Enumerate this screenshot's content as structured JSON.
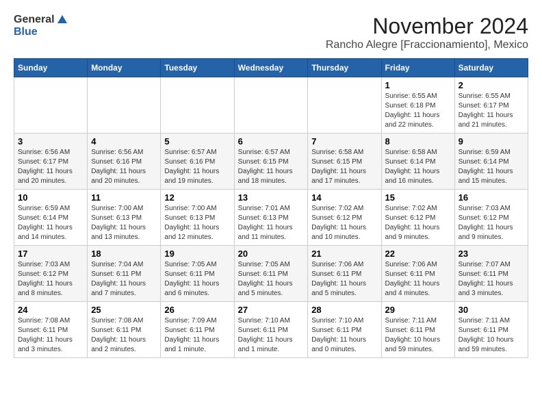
{
  "logo": {
    "general": "General",
    "blue": "Blue"
  },
  "title": "November 2024",
  "subtitle": "Rancho Alegre [Fraccionamiento], Mexico",
  "headers": [
    "Sunday",
    "Monday",
    "Tuesday",
    "Wednesday",
    "Thursday",
    "Friday",
    "Saturday"
  ],
  "weeks": [
    [
      {
        "day": "",
        "info": ""
      },
      {
        "day": "",
        "info": ""
      },
      {
        "day": "",
        "info": ""
      },
      {
        "day": "",
        "info": ""
      },
      {
        "day": "",
        "info": ""
      },
      {
        "day": "1",
        "info": "Sunrise: 6:55 AM\nSunset: 6:18 PM\nDaylight: 11 hours and 22 minutes."
      },
      {
        "day": "2",
        "info": "Sunrise: 6:55 AM\nSunset: 6:17 PM\nDaylight: 11 hours and 21 minutes."
      }
    ],
    [
      {
        "day": "3",
        "info": "Sunrise: 6:56 AM\nSunset: 6:17 PM\nDaylight: 11 hours and 20 minutes."
      },
      {
        "day": "4",
        "info": "Sunrise: 6:56 AM\nSunset: 6:16 PM\nDaylight: 11 hours and 20 minutes."
      },
      {
        "day": "5",
        "info": "Sunrise: 6:57 AM\nSunset: 6:16 PM\nDaylight: 11 hours and 19 minutes."
      },
      {
        "day": "6",
        "info": "Sunrise: 6:57 AM\nSunset: 6:15 PM\nDaylight: 11 hours and 18 minutes."
      },
      {
        "day": "7",
        "info": "Sunrise: 6:58 AM\nSunset: 6:15 PM\nDaylight: 11 hours and 17 minutes."
      },
      {
        "day": "8",
        "info": "Sunrise: 6:58 AM\nSunset: 6:14 PM\nDaylight: 11 hours and 16 minutes."
      },
      {
        "day": "9",
        "info": "Sunrise: 6:59 AM\nSunset: 6:14 PM\nDaylight: 11 hours and 15 minutes."
      }
    ],
    [
      {
        "day": "10",
        "info": "Sunrise: 6:59 AM\nSunset: 6:14 PM\nDaylight: 11 hours and 14 minutes."
      },
      {
        "day": "11",
        "info": "Sunrise: 7:00 AM\nSunset: 6:13 PM\nDaylight: 11 hours and 13 minutes."
      },
      {
        "day": "12",
        "info": "Sunrise: 7:00 AM\nSunset: 6:13 PM\nDaylight: 11 hours and 12 minutes."
      },
      {
        "day": "13",
        "info": "Sunrise: 7:01 AM\nSunset: 6:13 PM\nDaylight: 11 hours and 11 minutes."
      },
      {
        "day": "14",
        "info": "Sunrise: 7:02 AM\nSunset: 6:12 PM\nDaylight: 11 hours and 10 minutes."
      },
      {
        "day": "15",
        "info": "Sunrise: 7:02 AM\nSunset: 6:12 PM\nDaylight: 11 hours and 9 minutes."
      },
      {
        "day": "16",
        "info": "Sunrise: 7:03 AM\nSunset: 6:12 PM\nDaylight: 11 hours and 9 minutes."
      }
    ],
    [
      {
        "day": "17",
        "info": "Sunrise: 7:03 AM\nSunset: 6:12 PM\nDaylight: 11 hours and 8 minutes."
      },
      {
        "day": "18",
        "info": "Sunrise: 7:04 AM\nSunset: 6:11 PM\nDaylight: 11 hours and 7 minutes."
      },
      {
        "day": "19",
        "info": "Sunrise: 7:05 AM\nSunset: 6:11 PM\nDaylight: 11 hours and 6 minutes."
      },
      {
        "day": "20",
        "info": "Sunrise: 7:05 AM\nSunset: 6:11 PM\nDaylight: 11 hours and 5 minutes."
      },
      {
        "day": "21",
        "info": "Sunrise: 7:06 AM\nSunset: 6:11 PM\nDaylight: 11 hours and 5 minutes."
      },
      {
        "day": "22",
        "info": "Sunrise: 7:06 AM\nSunset: 6:11 PM\nDaylight: 11 hours and 4 minutes."
      },
      {
        "day": "23",
        "info": "Sunrise: 7:07 AM\nSunset: 6:11 PM\nDaylight: 11 hours and 3 minutes."
      }
    ],
    [
      {
        "day": "24",
        "info": "Sunrise: 7:08 AM\nSunset: 6:11 PM\nDaylight: 11 hours and 3 minutes."
      },
      {
        "day": "25",
        "info": "Sunrise: 7:08 AM\nSunset: 6:11 PM\nDaylight: 11 hours and 2 minutes."
      },
      {
        "day": "26",
        "info": "Sunrise: 7:09 AM\nSunset: 6:11 PM\nDaylight: 11 hours and 1 minute."
      },
      {
        "day": "27",
        "info": "Sunrise: 7:10 AM\nSunset: 6:11 PM\nDaylight: 11 hours and 1 minute."
      },
      {
        "day": "28",
        "info": "Sunrise: 7:10 AM\nSunset: 6:11 PM\nDaylight: 11 hours and 0 minutes."
      },
      {
        "day": "29",
        "info": "Sunrise: 7:11 AM\nSunset: 6:11 PM\nDaylight: 10 hours and 59 minutes."
      },
      {
        "day": "30",
        "info": "Sunrise: 7:11 AM\nSunset: 6:11 PM\nDaylight: 10 hours and 59 minutes."
      }
    ]
  ]
}
